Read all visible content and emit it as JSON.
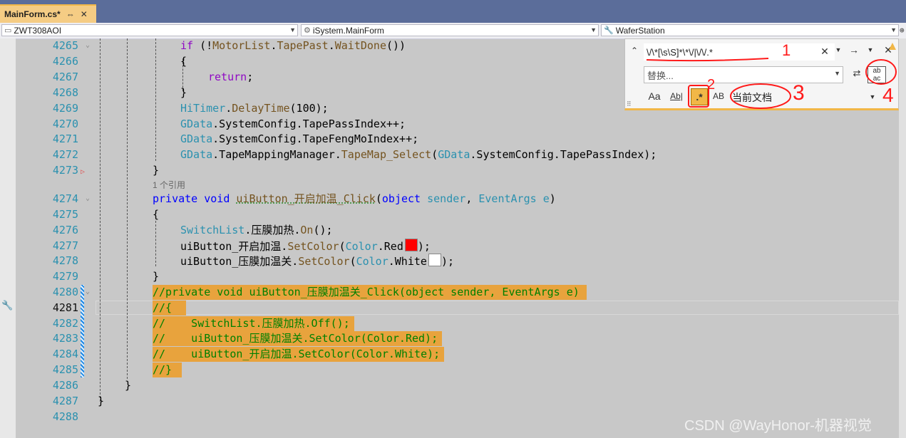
{
  "tab": {
    "title": "MainForm.cs*",
    "pin": "⇔",
    "close": "✕"
  },
  "nav": {
    "project": "ZWT308AOI",
    "klass": "iSystem.MainForm",
    "member": "WaferStation"
  },
  "editor": {
    "line_numbers": [
      "4265",
      "4266",
      "4267",
      "4268",
      "4269",
      "4270",
      "4271",
      "4272",
      "4273",
      "4274",
      "4275",
      "4276",
      "4277",
      "4278",
      "4279",
      "4280",
      "4281",
      "4282",
      "4283",
      "4284",
      "4285",
      "4286",
      "4287",
      "4288"
    ],
    "current_line": "4281",
    "references": "1 个引用",
    "code": {
      "l4265_a": "if",
      "l4265_b": " (!",
      "l4265_c": "MotorList",
      "l4265_d": ".",
      "l4265_e": "TapePast",
      "l4265_f": ".",
      "l4265_g": "WaitDone",
      "l4265_h": "())",
      "l4266": "{",
      "l4267_a": "return",
      "l4267_b": ";",
      "l4268": "}",
      "l4269_a": "HiTimer",
      "l4269_b": ".",
      "l4269_c": "DelayTime",
      "l4269_d": "(100);",
      "l4270_a": "GData",
      "l4270_b": ".SystemConfig.TapePassIndex++;",
      "l4271_a": "GData",
      "l4271_b": ".SystemConfig.TapeFengMoIndex++;",
      "l4272_a": "GData",
      "l4272_b": ".TapeMappingManager.",
      "l4272_c": "TapeMap_Select",
      "l4272_d": "(",
      "l4272_e": "GData",
      "l4272_f": ".SystemConfig.TapePassIndex);",
      "l4273": "}",
      "l4274_a": "private",
      "l4274_b": " ",
      "l4274_c": "void",
      "l4274_d": " ",
      "l4274_e": "uiButton_开启加温_Click",
      "l4274_f": "(",
      "l4274_g": "object",
      "l4274_h": " ",
      "l4274_i": "sender",
      "l4274_j": ", ",
      "l4274_k": "EventArgs",
      "l4274_l": " ",
      "l4274_m": "e",
      "l4274_n": ")",
      "l4275": "{",
      "l4276_a": "SwitchList",
      "l4276_b": ".压膜加热.",
      "l4276_c": "On",
      "l4276_d": "();",
      "l4277_a": "uiButton_开启加温.",
      "l4277_b": "SetColor",
      "l4277_c": "(",
      "l4277_d": "Color",
      "l4277_e": ".Red",
      "l4277_f": ");",
      "l4278_a": "uiButton_压膜加温关.",
      "l4278_b": "SetColor",
      "l4278_c": "(",
      "l4278_d": "Color",
      "l4278_e": ".White",
      "l4278_f": ");",
      "l4279": "}",
      "l4280": "//private void uiButton_压膜加温关_Click(object sender, EventArgs e)",
      "l4281": "//{",
      "l4282": "//    SwitchList.压膜加热.Off();",
      "l4283": "//    uiButton_压膜加温关.SetColor(Color.Red);",
      "l4284": "//    uiButton_开启加温.SetColor(Color.White);",
      "l4285": "//}",
      "l4286": "}",
      "l4287": "}"
    }
  },
  "find": {
    "search_value": "\\/\\*[\\s\\S]*\\*\\/|\\/\\/.*",
    "replace_placeholder": "替换...",
    "match_case": "Aa",
    "whole_word": "Ab|",
    "regex": ".*",
    "preserve_case": "AB",
    "scope": "当前文档"
  },
  "annotations": [
    "1",
    "2",
    "3",
    "4"
  ],
  "watermark": "CSDN @WayHonor-机器视觉",
  "colors": {
    "highlight": "#e8a33d",
    "tab": "#f5cc84",
    "line_number": "#2b91af",
    "keyword": "#0000ff",
    "comment": "#008000",
    "annotation": "#ff1a1a"
  }
}
